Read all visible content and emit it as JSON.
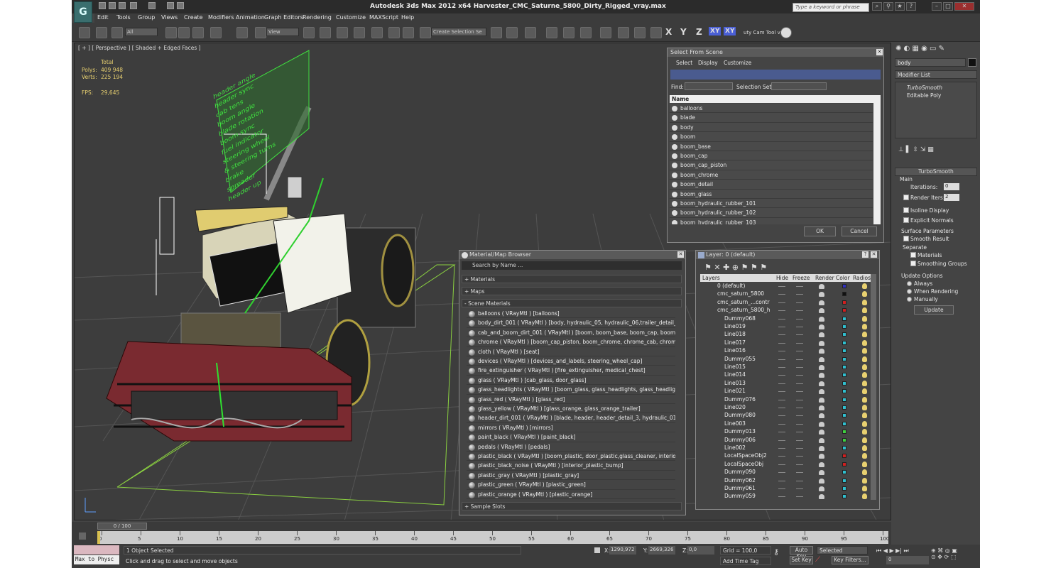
{
  "app": {
    "title": "Autodesk 3ds Max  2012 x64     Harvester_CMC_Saturne_5800_Dirty_Rigged_vray.max",
    "search_placeholder": "Type a keyword or phrase"
  },
  "menu": [
    "Edit",
    "Tools",
    "Group",
    "Views",
    "Create",
    "Modifiers",
    "Animation",
    "Graph Editors",
    "Rendering",
    "Customize",
    "MAXScript",
    "Help"
  ],
  "toolbar": {
    "filter": "All",
    "refcoord": "View",
    "selset": "Create Selection Se",
    "axes": [
      "X",
      "Y",
      "Z",
      "XY",
      "XY"
    ],
    "camtool": "uty Cam Tool v"
  },
  "viewport": {
    "label": "[ + ] [ Perspective ] [ Shaded + Edged Faces ]",
    "stats_total": "Total",
    "polys_label": "Polys:",
    "polys_val": "409 948",
    "verts_label": "Verts:",
    "verts_val": "225 194",
    "fps_label": "FPS:",
    "fps_val": "29,645",
    "signboard": [
      "header angle",
      "header sync",
      "cab tens",
      "boom angle",
      "blade rotation",
      "boom sync",
      "fuel indicator",
      "steering wheel",
      "& steering turns",
      "brake",
      "spreader",
      "header up"
    ]
  },
  "select_scene": {
    "title": "Select From Scene",
    "menu": [
      "Select",
      "Display",
      "Customize"
    ],
    "find_label": "Find:",
    "selset_label": "Selection Set:",
    "col_name": "Name",
    "items": [
      "balloons",
      "blade",
      "body",
      "boom",
      "boom_base",
      "boom_cap",
      "boom_cap_piston",
      "boom_chrome",
      "boom_detail",
      "boom_glass",
      "boom_hydraulic_rubber_101",
      "boom_hydraulic_rubber_102",
      "boom_hydraulic_rubber_103"
    ],
    "ok": "OK",
    "cancel": "Cancel"
  },
  "mat_browser": {
    "title": "Material/Map Browser",
    "search": "Search by Name ...",
    "sections": [
      "+ Materials",
      "+ Maps",
      "- Scene Materials"
    ],
    "sample": "+ Sample Slots",
    "items": [
      "balloons  ( VRayMtl ) [balloons]",
      "body_dirt_001  ( VRayMtl ) [body, hydraulic_05, hydraulic_06,trailer_detail_01,...",
      "cab_and_boom_dirt_001  ( VRayMtl ) [boom, boom_base, boom_cap, boom_det...",
      "chrome  ( VRayMtl ) [boom_cap_piston, boom_chrome, chrome_cab, chrome_tr...",
      "cloth  ( VRayMtl ) [seat]",
      "devices  ( VRayMtl ) [devices_and_labels, steering_wheel_cap]",
      "fire_extinguisher  ( VRayMtl ) [fire_extinguisher, medical_chest]",
      "glass  ( VRayMtl ) [cab_glass, door_glass]",
      "glass_headlights  ( VRayMtl ) [boom_glass, glass_headlights, glass_headlights_t...",
      "glass_red  ( VRayMtl ) [glass_red]",
      "glass_yellow  ( VRayMtl ) [glass_orange, glass_orange_trailer]",
      "header_dirt_001  ( VRayMtl ) [blade, header, header_detail_3, hydraulic_01, hy...",
      "mirrors  ( VRayMtl ) [mirrors]",
      "paint_black  ( VRayMtl ) [paint_black]",
      "pedals  ( VRayMtl ) [pedals]",
      "plastic_black  ( VRayMtl ) [boom_plastic, door_plastic,glass_cleaner, interior_pl...",
      "plastic_black_noise  ( VRayMtl ) [interior_plastic_bump]",
      "plastic_gray  ( VRayMtl ) [plastic_gray]",
      "plastic_green  ( VRayMtl ) [plastic_green]",
      "plastic_orange  ( VRayMtl ) [plastic_orange]"
    ]
  },
  "layer": {
    "title": "Layer: 0 (default)",
    "cols": [
      "Layers",
      "Hide",
      "Freeze",
      "Render",
      "Color",
      "Radios"
    ],
    "items": [
      {
        "n": "0 (default)",
        "c": "#3030c0"
      },
      {
        "n": "cmc_saturn_5800",
        "c": "#111111"
      },
      {
        "n": "cmc_saturn_...contr",
        "c": "#d02020"
      },
      {
        "n": "cmc_saturn_5800_h",
        "c": "#d02020"
      },
      {
        "n": "Dummy068",
        "c": "#30c0d0"
      },
      {
        "n": "Line019",
        "c": "#30c0d0"
      },
      {
        "n": "Line018",
        "c": "#30c0d0"
      },
      {
        "n": "Line017",
        "c": "#30c0d0"
      },
      {
        "n": "Line016",
        "c": "#30c0d0"
      },
      {
        "n": "Dummy055",
        "c": "#30c0d0"
      },
      {
        "n": "Line015",
        "c": "#30c0d0"
      },
      {
        "n": "Line014",
        "c": "#30c0d0"
      },
      {
        "n": "Line013",
        "c": "#30c0d0"
      },
      {
        "n": "Line021",
        "c": "#30c0d0"
      },
      {
        "n": "Dummy076",
        "c": "#30c0d0"
      },
      {
        "n": "Line020",
        "c": "#30c0d0"
      },
      {
        "n": "Dummy080",
        "c": "#30c0d0"
      },
      {
        "n": "Line003",
        "c": "#30c0d0"
      },
      {
        "n": "Dummy013",
        "c": "#40d040"
      },
      {
        "n": "Dummy006",
        "c": "#40d040"
      },
      {
        "n": "Line002",
        "c": "#30c0d0"
      },
      {
        "n": "LocalSpaceObj2",
        "c": "#d02020"
      },
      {
        "n": "LocalSpaceObj",
        "c": "#d02020"
      },
      {
        "n": "Dummy090",
        "c": "#30c0d0"
      },
      {
        "n": "Dummy062",
        "c": "#30c0d0"
      },
      {
        "n": "Dummy061",
        "c": "#30c0d0"
      },
      {
        "n": "Dummy059",
        "c": "#30c0d0"
      }
    ]
  },
  "cmd": {
    "name": "body",
    "modlist": "Modifier List",
    "stack": [
      "TurboSmooth",
      "Editable Poly"
    ],
    "rollout": "TurboSmooth",
    "main": "Main",
    "iter_label": "Iterations:",
    "iter_val": "0",
    "render_label": "Render Iters:",
    "render_val": "2",
    "isoline": "Isoline Display",
    "explicit": "Explicit Normals",
    "surface": "Surface Parameters",
    "smooth": "Smooth Result",
    "separate": "Separate",
    "materials": "Materials",
    "smoothing": "Smoothing Groups",
    "update_opts": "Update Options",
    "always": "Always",
    "when_rend": "When Rendering",
    "manually": "Manually",
    "update": "Update"
  },
  "timeline": {
    "frame": "0 / 100",
    "ticks": [
      "0",
      "5",
      "10",
      "15",
      "20",
      "25",
      "30",
      "35",
      "40",
      "45",
      "50",
      "55",
      "60",
      "65",
      "70",
      "75",
      "80",
      "85",
      "90",
      "95",
      "100"
    ]
  },
  "status": {
    "script": "Max to Physc",
    "selected": "1 Object Selected",
    "hint": "Click and drag to select and move objects",
    "x_label": "X:",
    "x_val": "1290,972",
    "y_label": "Y:",
    "y_val": "2669,326",
    "z_label": "Z:",
    "z_val": "0,0",
    "grid": "Grid = 100,0",
    "addtag": "Add Time Tag",
    "autokey": "Auto Key",
    "setkey": "Set Key",
    "sel_dd": "Selected",
    "keyfilters": "Key Filters...",
    "frame": "0"
  }
}
